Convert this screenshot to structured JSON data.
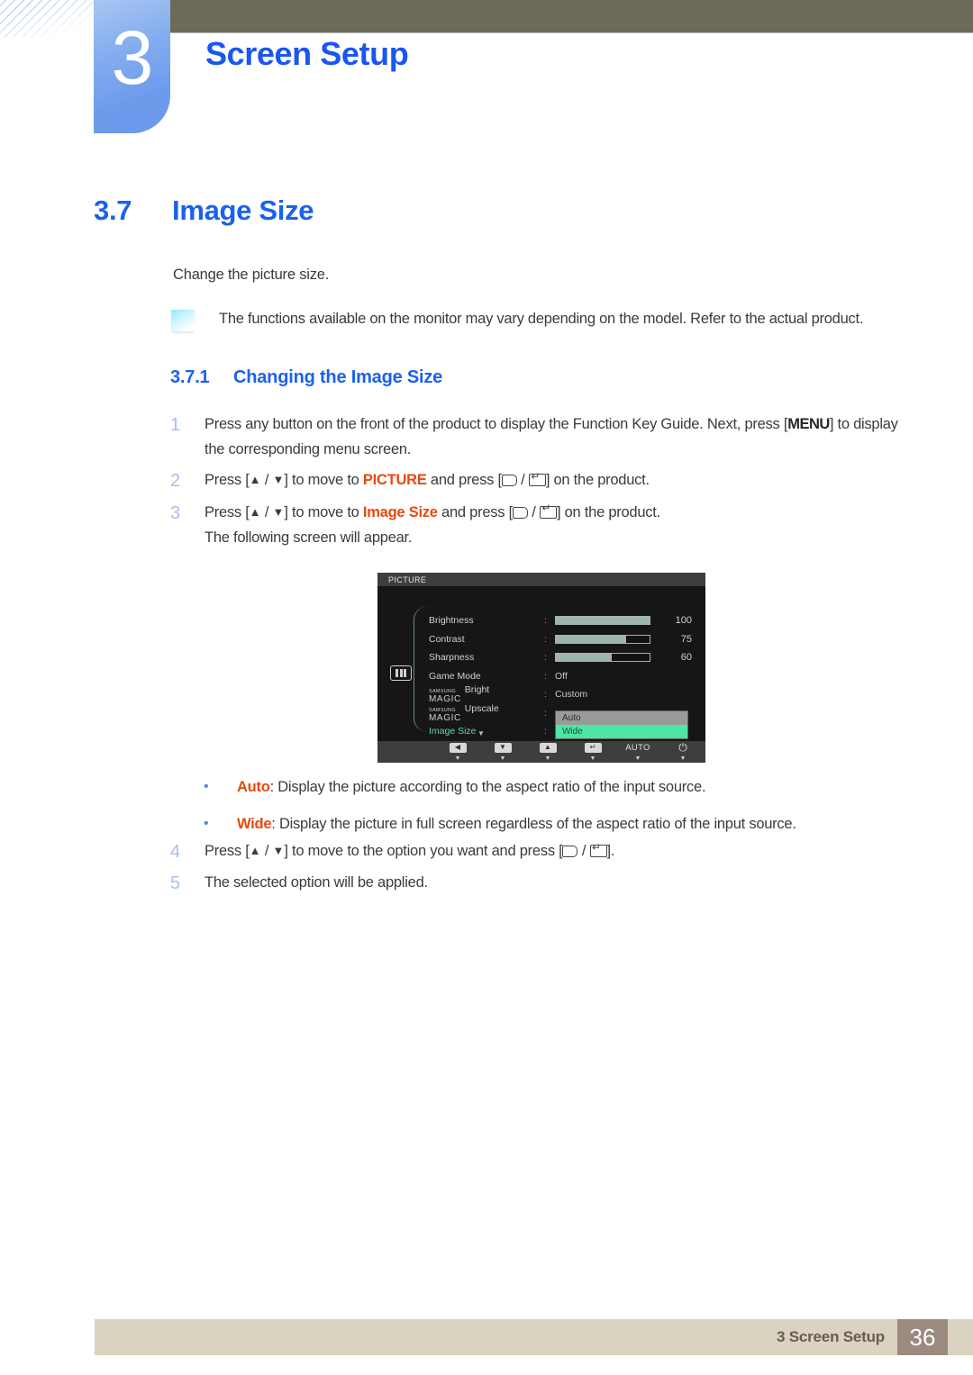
{
  "header": {
    "chapter_number": "3",
    "chapter_title": "Screen Setup"
  },
  "section": {
    "number": "3.7",
    "title": "Image Size",
    "intro": "Change the picture size.",
    "note": "The functions available on the monitor may vary depending on the model. Refer to the actual product."
  },
  "subsection": {
    "number": "3.7.1",
    "title": "Changing the Image Size"
  },
  "steps_first": [
    {
      "num": "1",
      "parts": [
        {
          "t": "Press any button on the front of the product to display the Function Key Guide. Next, press [",
          "style": "plain"
        },
        {
          "t": "MENU",
          "style": "bold"
        },
        {
          "t": "] to display the corresponding menu screen.",
          "style": "plain"
        }
      ]
    },
    {
      "num": "2",
      "parts": [
        {
          "t": "Press [",
          "style": "plain"
        },
        {
          "t": "▲",
          "style": "tri"
        },
        {
          "t": " / ",
          "style": "plain"
        },
        {
          "t": "▼",
          "style": "tri"
        },
        {
          "t": "] to move to ",
          "style": "plain"
        },
        {
          "t": "PICTURE",
          "style": "orange"
        },
        {
          "t": " and press [",
          "style": "plain"
        },
        {
          "t": "",
          "style": "key-back"
        },
        {
          "t": " / ",
          "style": "plain"
        },
        {
          "t": "",
          "style": "key-enter"
        },
        {
          "t": "] on the product.",
          "style": "plain"
        }
      ]
    },
    {
      "num": "3",
      "parts": [
        {
          "t": "Press [",
          "style": "plain"
        },
        {
          "t": "▲",
          "style": "tri"
        },
        {
          "t": " / ",
          "style": "plain"
        },
        {
          "t": "▼",
          "style": "tri"
        },
        {
          "t": "] to move to ",
          "style": "plain"
        },
        {
          "t": "Image Size",
          "style": "orange"
        },
        {
          "t": " and press [",
          "style": "plain"
        },
        {
          "t": "",
          "style": "key-back"
        },
        {
          "t": " / ",
          "style": "plain"
        },
        {
          "t": "",
          "style": "key-enter"
        },
        {
          "t": "] on the product.",
          "style": "plain"
        },
        {
          "t": "\n",
          "style": "br"
        },
        {
          "t": "The following screen will appear.",
          "style": "plain"
        }
      ]
    }
  ],
  "steps_second": [
    {
      "num": "4",
      "parts": [
        {
          "t": "Press [",
          "style": "plain"
        },
        {
          "t": "▲",
          "style": "tri"
        },
        {
          "t": " / ",
          "style": "plain"
        },
        {
          "t": "▼",
          "style": "tri"
        },
        {
          "t": "] to move to the option you want and press [",
          "style": "plain"
        },
        {
          "t": "",
          "style": "key-back"
        },
        {
          "t": " / ",
          "style": "plain"
        },
        {
          "t": "",
          "style": "key-enter"
        },
        {
          "t": "].",
          "style": "plain"
        }
      ]
    },
    {
      "num": "5",
      "parts": [
        {
          "t": "The selected option will be applied.",
          "style": "plain"
        }
      ]
    }
  ],
  "bullets": [
    {
      "term": "Auto",
      "desc": ": Display the picture according to the aspect ratio of the input source."
    },
    {
      "term": "Wide",
      "desc": ": Display the picture in full screen regardless of the aspect ratio of the input source."
    }
  ],
  "osd": {
    "title": "PICTURE",
    "category_icon": "picture-bars-icon",
    "rows": [
      {
        "label": "Brightness",
        "type": "slider",
        "value": "100",
        "fill_percent": 100
      },
      {
        "label": "Contrast",
        "type": "slider",
        "value": "75",
        "fill_percent": 75
      },
      {
        "label": "Sharpness",
        "type": "slider",
        "value": "60",
        "fill_percent": 60
      },
      {
        "label": "Game Mode",
        "type": "option",
        "value": "Off"
      },
      {
        "label": "Bright",
        "type": "magic-option",
        "brand_top": "SAMSUNG",
        "brand_main": "MAGIC",
        "value": "Custom"
      },
      {
        "label": "Upscale",
        "type": "magic-option",
        "brand_top": "SAMSUNG",
        "brand_main": "MAGIC",
        "value": ""
      },
      {
        "label": "Image Size",
        "type": "selected",
        "value": ""
      }
    ],
    "submenu": [
      {
        "label": "Auto",
        "state": "normal"
      },
      {
        "label": "Wide",
        "state": "active"
      }
    ],
    "more_indicator": "▼",
    "toolbar": [
      {
        "name": "left-arrow-button",
        "glyph": "◀",
        "kind": "key"
      },
      {
        "name": "down-arrow-button",
        "glyph": "▼",
        "kind": "key"
      },
      {
        "name": "up-arrow-button",
        "glyph": "▲",
        "kind": "key"
      },
      {
        "name": "enter-button",
        "glyph": "↵",
        "kind": "key"
      },
      {
        "name": "auto-button",
        "glyph": "AUTO",
        "kind": "text"
      },
      {
        "name": "power-button",
        "glyph": "⏻",
        "kind": "power"
      }
    ],
    "colors": {
      "background": "#161616",
      "titlebar": "#3e3e3e",
      "slider_fill": "#9fb3b0",
      "selected_text": "#5fd9a5",
      "highlight": "#4ee6a4"
    }
  },
  "footer": {
    "label": "3 Screen Setup",
    "page": "36"
  },
  "colors": {
    "heading_blue": "#1a61f0",
    "keyword_orange": "#e8490f",
    "chapter_tab_blue": "#6d9bec",
    "olive_bar": "#6d6b57",
    "footer_bar": "#d9d3c0",
    "footer_page_box": "#9a8a80"
  }
}
